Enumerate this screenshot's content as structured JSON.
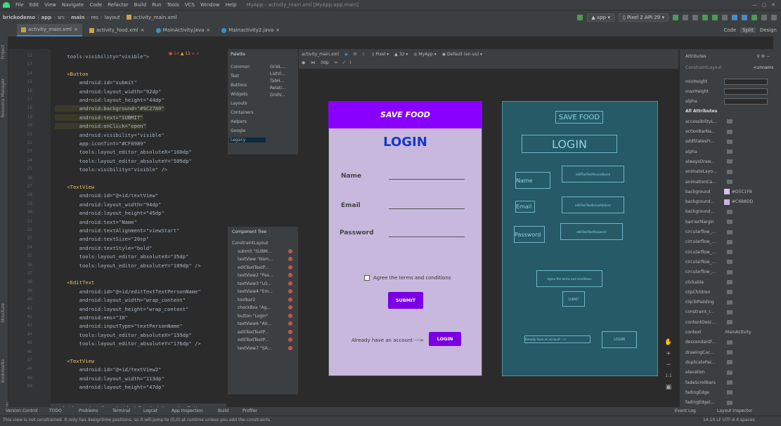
{
  "menu": [
    "File",
    "Edit",
    "View",
    "Navigate",
    "Code",
    "Refactor",
    "Build",
    "Run",
    "Tools",
    "VCS",
    "Window",
    "Help"
  ],
  "window_title": "MyApp - activity_main.xml [MyApp.app.main]",
  "breadcrumbs": [
    "brickodemo",
    "app",
    "src",
    "main",
    "res",
    "layout",
    "activity_main.xml"
  ],
  "run_config": "app",
  "device": "Pixel 2 API 29",
  "editor_tabs": [
    "activity_main.xml",
    "activity_food.xml",
    "MainActivity.java",
    "Mainactivity2.java"
  ],
  "view_modes": [
    "Code",
    "Split",
    "Design"
  ],
  "warnings": {
    "errors": "14",
    "warnings": "11"
  },
  "design_toolbar": {
    "file": "activity_main.xml",
    "device": "Pixel",
    "api": "32",
    "theme": "MyApp",
    "locale": "Default (en-us)",
    "margin": "0dp"
  },
  "palette": {
    "title": "Palette",
    "categories": [
      "Common",
      "Text",
      "Buttons",
      "Widgets",
      "Layouts",
      "Containers",
      "Helpers",
      "Google",
      "Legacy"
    ],
    "items": [
      "GridL...",
      "ListVi...",
      "TabH...",
      "Relati...",
      "GridV..."
    ]
  },
  "component_tree": {
    "title": "Component Tree",
    "items": [
      "ConstraintLayout",
      "submit \"SUBM...",
      "textView \"Nam...",
      "editTextTextP...",
      "textView2 \"Pas...",
      "textView3 \"LO...",
      "textView4 \"Em...",
      "toolbar2",
      "checkBox \"Ag...",
      "button \"Login\"",
      "textView6 \"Alr...",
      "editTextTextP...",
      "editTextTextP...",
      "textView7 \"SA..."
    ]
  },
  "code_lines": [
    {
      "n": "12",
      "t": "    tools:visibility=\"visible\">"
    },
    {
      "n": "13",
      "t": ""
    },
    {
      "n": "14",
      "t": "    <Button"
    },
    {
      "n": "15",
      "t": "        android:id=\"submit\""
    },
    {
      "n": "16",
      "t": "        android:layout_width=\"92dp\""
    },
    {
      "n": "17",
      "t": "        android:layout_height=\"44dp\""
    },
    {
      "n": "18",
      "t": "        android:background=\"#9C2780\""
    },
    {
      "n": "19",
      "t": "        android:text=\"SUBMIT\""
    },
    {
      "n": "20",
      "t": "        android:onClick=\"open\""
    },
    {
      "n": "21",
      "t": "        android:visibility=\"visible\""
    },
    {
      "n": "22",
      "t": "        app:iconTint=\"#CF8989\""
    },
    {
      "n": "23",
      "t": "        tools:layout_editor_absoluteX=\"160dp\""
    },
    {
      "n": "24",
      "t": "        tools:layout_editor_absoluteY=\"509dp\""
    },
    {
      "n": "25",
      "t": "        tools:visibility=\"visible\" />"
    },
    {
      "n": "26",
      "t": ""
    },
    {
      "n": "27",
      "t": "    <TextView"
    },
    {
      "n": "28",
      "t": "        android:id=\"@+id/textView\""
    },
    {
      "n": "29",
      "t": "        android:layout_width=\"94dp\""
    },
    {
      "n": "30",
      "t": "        android:layout_height=\"45dp\""
    },
    {
      "n": "31",
      "t": "        android:text=\"Name\""
    },
    {
      "n": "32",
      "t": "        android:textAlignment=\"viewStart\""
    },
    {
      "n": "33",
      "t": "        android:textSize=\"20sp\""
    },
    {
      "n": "34",
      "t": "        android:textStyle=\"bold\""
    },
    {
      "n": "35",
      "t": "        tools:layout_editor_absoluteX=\"35dp\""
    },
    {
      "n": "36",
      "t": "        tools:layout_editor_absoluteY=\"189dp\" />"
    },
    {
      "n": "37",
      "t": ""
    },
    {
      "n": "38",
      "t": "    <EditText"
    },
    {
      "n": "39",
      "t": "        android:id=\"@+id/editTextTextPersonName\""
    },
    {
      "n": "40",
      "t": "        android:layout_width=\"wrap_content\""
    },
    {
      "n": "41",
      "t": "        android:layout_height=\"wrap_content\""
    },
    {
      "n": "42",
      "t": "        android:ems=\"10\""
    },
    {
      "n": "43",
      "t": "        android:inputType=\"textPersonName\""
    },
    {
      "n": "44",
      "t": "        tools:layout_editor_absoluteX=\"159dp\""
    },
    {
      "n": "45",
      "t": "        tools:layout_editor_absoluteY=\"176dp\" />"
    },
    {
      "n": "46",
      "t": ""
    },
    {
      "n": "47",
      "t": "    <TextView"
    },
    {
      "n": "48",
      "t": "        android:id=\"@+id/textView2\""
    },
    {
      "n": "49",
      "t": "        android:layout_width=\"113dp\""
    },
    {
      "n": "50",
      "t": "        android:layout_height=\"47dp\""
    }
  ],
  "editor_breadcrumb": "androidx.constraintlayout.widget.ConstraintLayout  >  Button",
  "preview": {
    "app_title": "SAVE FOOD",
    "login": "LOGIN",
    "name": "Name",
    "email": "Email",
    "password": "Password",
    "agree": "Agree the terms and conditions",
    "submit": "SUBMIT",
    "already": "Already have an account --->",
    "login_btn": "LOGIN"
  },
  "blueprint": {
    "app_title": "SAVE FOOD",
    "login": "LOGIN",
    "name": "Name",
    "email": "Email",
    "password": "Password",
    "edit_name": "editTextTextPersonName",
    "edit_email": "editTextTextEmailAddress",
    "edit_pass": "editTextTextPassword",
    "agree": "Agree the terms and conditions",
    "submit": "SUBMIT",
    "already": "Already have an account --->",
    "login_btn": "LOGIN"
  },
  "attributes": {
    "title": "Attributes",
    "layout": "ConstraintLayout",
    "layout_id": "<unnamed>",
    "rows": [
      {
        "n": "minHeight",
        "v": ""
      },
      {
        "n": "maxHeight",
        "v": ""
      },
      {
        "n": "alpha",
        "v": ""
      },
      {
        "n": "All Attributes",
        "v": "",
        "h": true
      },
      {
        "n": "accessibilityL...",
        "v": ""
      },
      {
        "n": "actionBarNa...",
        "v": ""
      },
      {
        "n": "addStatesFr...",
        "v": ""
      },
      {
        "n": "alpha",
        "v": ""
      },
      {
        "n": "alwaysDraw...",
        "v": ""
      },
      {
        "n": "animateLayo...",
        "v": ""
      },
      {
        "n": "animationCa...",
        "v": ""
      },
      {
        "n": "background",
        "v": "#D5C1F8",
        "c": "#D5C1F8"
      },
      {
        "n": "background...",
        "v": "#C6B8DD",
        "c": "#C6B8DD"
      },
      {
        "n": "background...",
        "v": ""
      },
      {
        "n": "barrierMargin",
        "v": ""
      },
      {
        "n": "circularflow_...",
        "v": ""
      },
      {
        "n": "circularflow_...",
        "v": ""
      },
      {
        "n": "circularflow_...",
        "v": ""
      },
      {
        "n": "circularflow_...",
        "v": ""
      },
      {
        "n": "circularflow_...",
        "v": ""
      },
      {
        "n": "clickable",
        "v": ""
      },
      {
        "n": "clipChildren",
        "v": ""
      },
      {
        "n": "clipToPadding",
        "v": ""
      },
      {
        "n": "constraint_r...",
        "v": ""
      },
      {
        "n": "contentDesc...",
        "v": ""
      },
      {
        "n": "context",
        "v": ".MainActivity"
      },
      {
        "n": "descendantF...",
        "v": ""
      },
      {
        "n": "drawingCac...",
        "v": ""
      },
      {
        "n": "duplicatePar...",
        "v": ""
      },
      {
        "n": "elevation",
        "v": ""
      },
      {
        "n": "fadeScrollbars",
        "v": ""
      },
      {
        "n": "fadingEdge",
        "v": ""
      },
      {
        "n": "fadingEdgel...",
        "v": ""
      }
    ]
  },
  "status": {
    "tools": [
      "Version Control",
      "TODO",
      "Problems",
      "Terminal",
      "Logcat",
      "App Inspection",
      "Build",
      "Profiler"
    ],
    "right": [
      "Event Log",
      "Layout Inspector"
    ],
    "message": "This view is not constrained. It only has designtime positions, so it will jump to (0,0) at runtime unless you add the constraints",
    "pos": "14:10  LF  UTF-8  4 spaces"
  },
  "left_tabs": [
    "Project",
    "Resource Manager",
    "Structure",
    "Bookmarks",
    "Build Variants"
  ]
}
